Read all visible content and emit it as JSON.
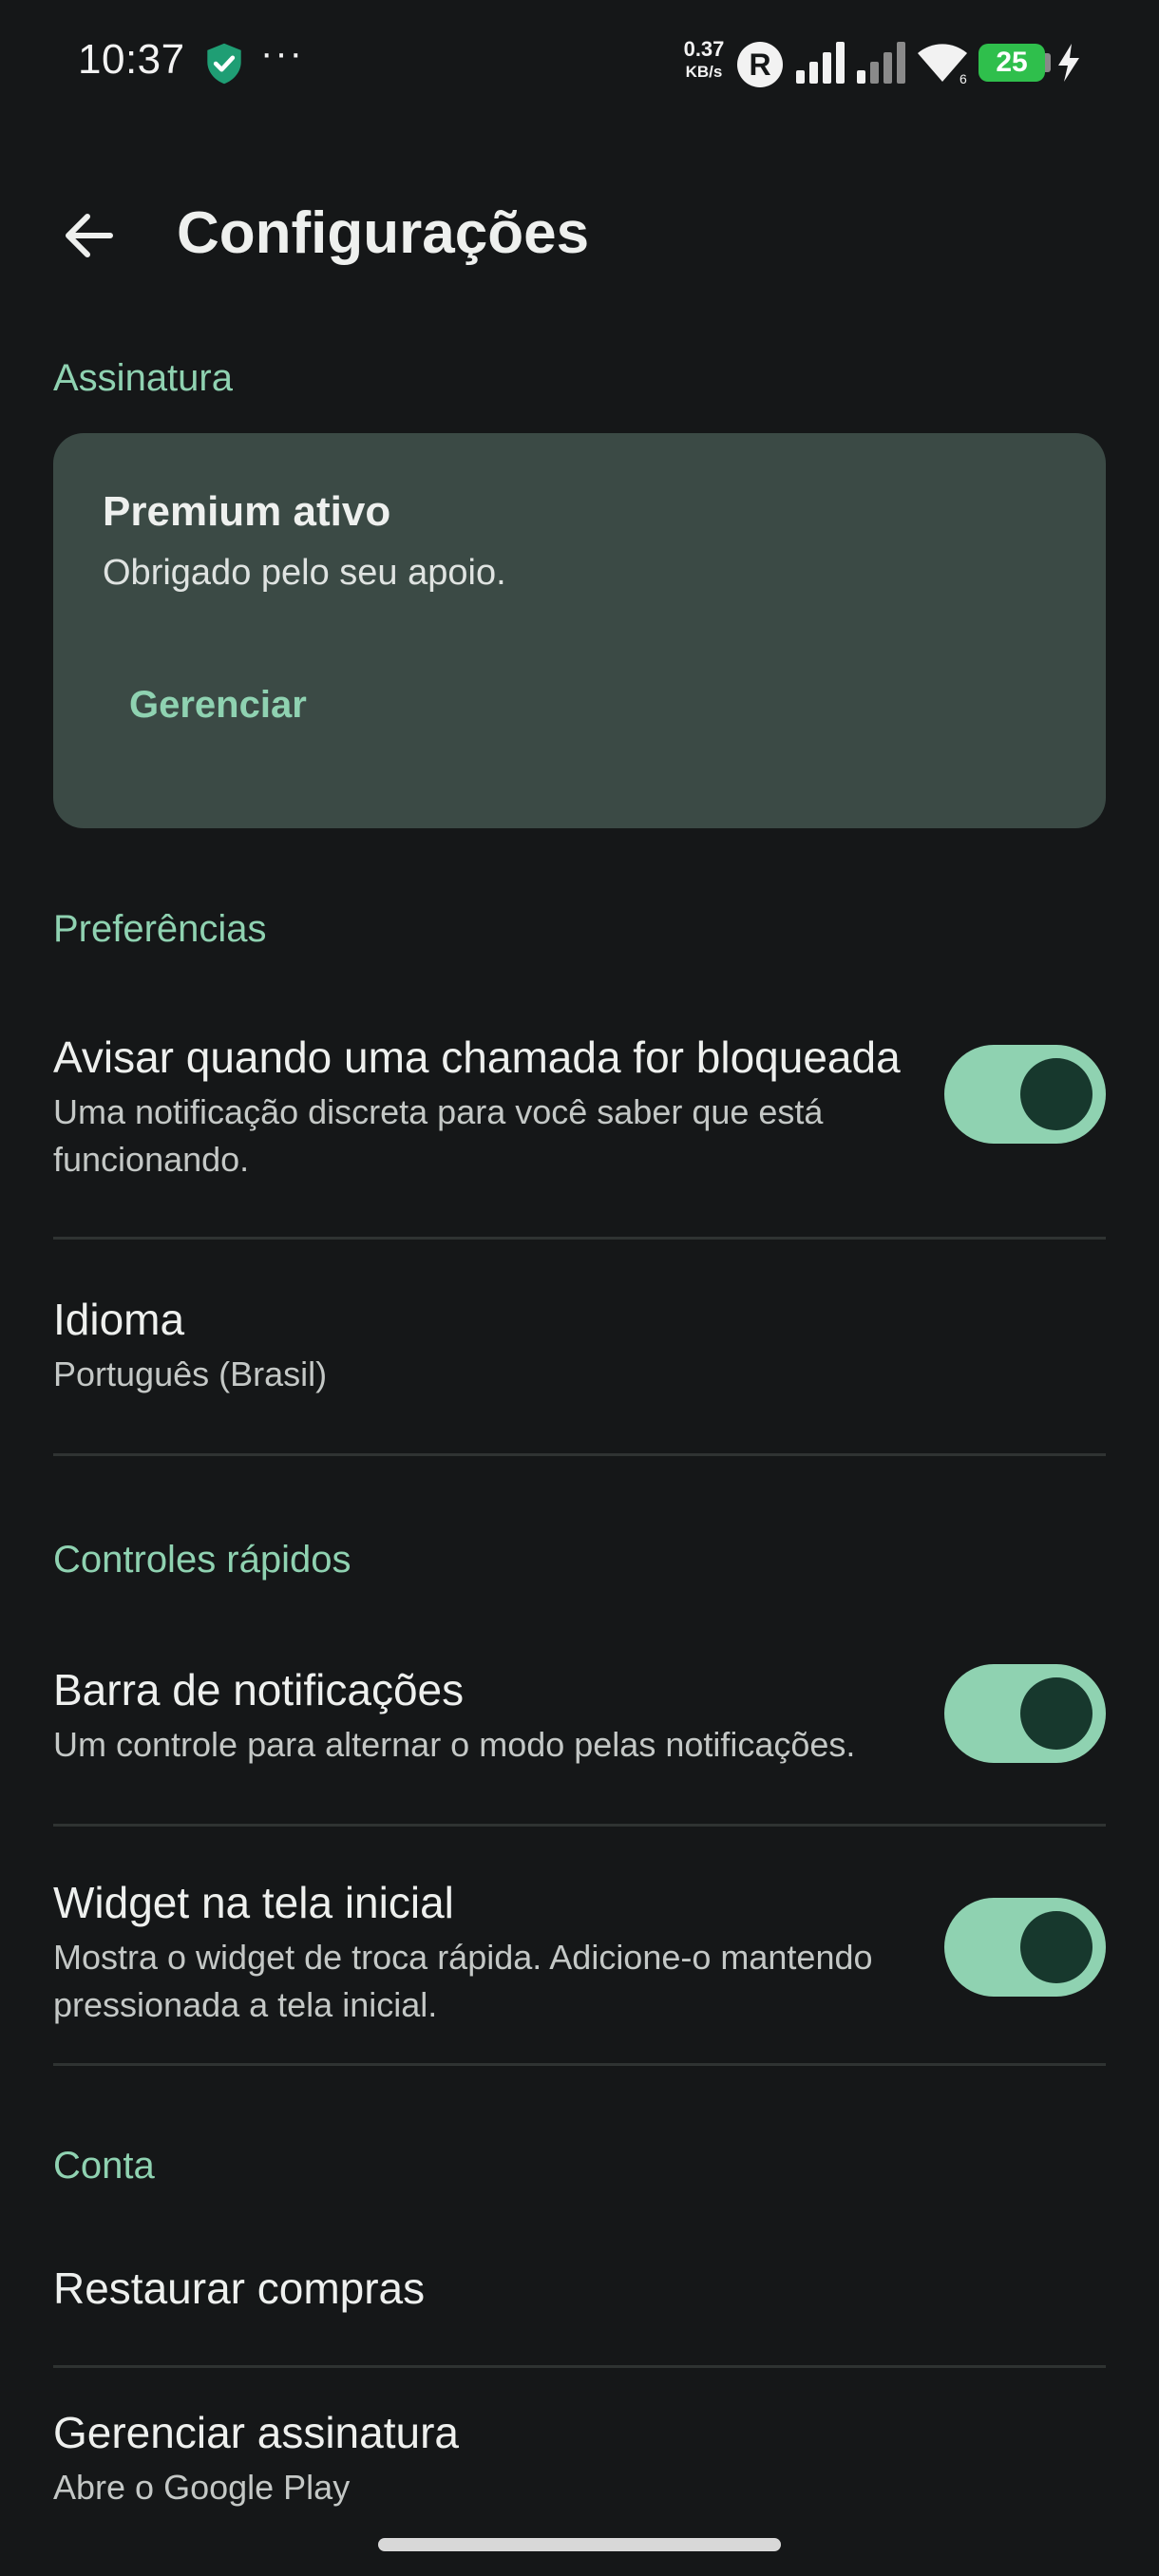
{
  "status_bar": {
    "time": "10:37",
    "dots": "···",
    "net_speed_value": "0.37",
    "net_speed_unit": "KB/s",
    "roaming_badge": "R",
    "battery_level": "25",
    "icons": [
      "shield-check-icon",
      "signal-icon",
      "signal-icon",
      "wifi-icon",
      "battery-icon",
      "charging-bolt-icon"
    ]
  },
  "header": {
    "back_icon": "arrow-left-icon",
    "title": "Configurações"
  },
  "subscription": {
    "section_label": "Assinatura",
    "card_title": "Premium ativo",
    "card_subtitle": "Obrigado pelo seu apoio.",
    "manage_button": "Gerenciar"
  },
  "preferences": {
    "section_label": "Preferências",
    "blocked_call_notify": {
      "title": "Avisar quando uma chamada for bloqueada",
      "subtitle": "Uma notificação discreta para você saber que está funcionando.",
      "enabled": true
    },
    "language": {
      "title": "Idioma",
      "value": "Português (Brasil)"
    }
  },
  "quick_controls": {
    "section_label": "Controles rápidos",
    "notification_bar": {
      "title": "Barra de notificações",
      "subtitle": "Um controle para alternar o modo pelas notificações.",
      "enabled": true
    },
    "home_widget": {
      "title": "Widget na tela inicial",
      "subtitle": "Mostra o widget de troca rápida. Adicione-o mantendo pressionada a tela inicial.",
      "enabled": true
    }
  },
  "account": {
    "section_label": "Conta",
    "restore_purchases": {
      "title": "Restaurar compras"
    },
    "manage_subscription": {
      "title": "Gerenciar assinatura",
      "subtitle": "Abre o Google Play"
    }
  },
  "colors": {
    "background": "#151718",
    "accent": "#8fd2b1",
    "card": "#3b4a45",
    "toggle_knob": "#17382d",
    "battery": "#2fbf4c"
  }
}
